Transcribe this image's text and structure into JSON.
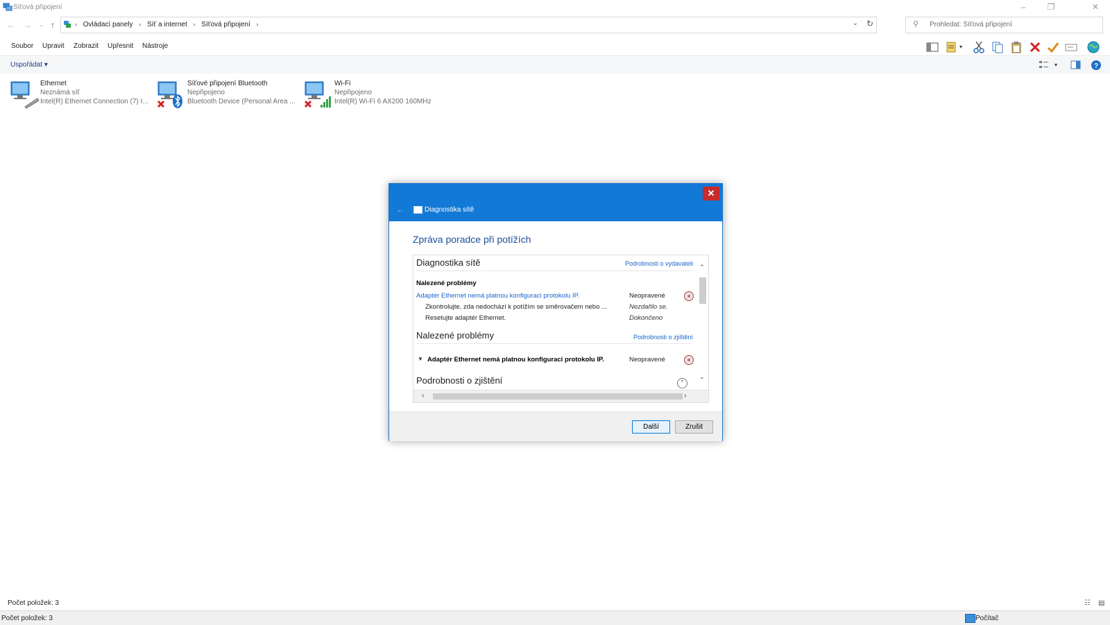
{
  "window": {
    "title": "Síťová připojení",
    "controls": [
      "–",
      "❐",
      "✕"
    ]
  },
  "address": {
    "crumbs": [
      "Ovládací panely",
      "Síť a internet",
      "Síťová připojení"
    ],
    "search_placeholder": "Prohledat: Síťová připojení"
  },
  "menu": {
    "items": [
      "Soubor",
      "Upravit",
      "Zobrazit",
      "Upřesnit",
      "Nástroje"
    ]
  },
  "toolbar": {
    "icons": [
      "layout-icon",
      "properties-icon",
      "cut-icon",
      "copy-icon",
      "paste-icon",
      "delete-icon",
      "check-icon",
      "rename-icon",
      "globe-icon"
    ]
  },
  "commandbar": {
    "organize": "Uspořádat"
  },
  "connections": [
    {
      "name": "Ethernet",
      "status": "Neznámá síť",
      "device": "Intel(R) Ethernet Connection (7) I...",
      "icon": "ethernet-icon",
      "disabled": false
    },
    {
      "name": "Síťové připojení Bluetooth",
      "status": "Nepřipojeno",
      "device": "Bluetooth Device (Personal Area ...",
      "icon": "bluetooth-icon",
      "disabled": true
    },
    {
      "name": "Wi-Fi",
      "status": "Nepřipojeno",
      "device": "Intel(R) Wi-Fi 6 AX200 160MHz",
      "icon": "wifi-icon",
      "disabled": true
    }
  ],
  "dialog": {
    "title": "Diagnostika sítě",
    "heading": "Zpráva poradce při potížích",
    "section1": {
      "title": "Diagnostika sítě",
      "link": "Podrobnosti o vydavateli",
      "subheading": "Nalezené problémy",
      "problem": "Adaptér Ethernet nemá platnou konfiguraci protokolu IP.",
      "problem_status": "Neopravené",
      "step1": "Zkontrolujte, zda nedochází k potížím se směrovačem nebo ...",
      "step1_status": "Nezdařilo se.",
      "step2": "Resetujte adaptér Ethernet.",
      "step2_status": "Dokončeno"
    },
    "section2": {
      "title": "Nalezené problémy",
      "link": "Podrobnosti o zjištění",
      "problem": "Adaptér Ethernet nemá platnou konfiguraci protokolu IP.",
      "problem_status": "Neopravené"
    },
    "section3": {
      "title": "Podrobnosti o zjištění"
    },
    "buttons": {
      "next": "Další",
      "cancel": "Zrušit"
    }
  },
  "status": {
    "count": "Počet položek: 3",
    "bottom_count": "Počet položek: 3",
    "computer": "Počítač"
  },
  "colors": {
    "accent": "#1279d6",
    "link": "#1a64c8",
    "error": "#b33333"
  }
}
